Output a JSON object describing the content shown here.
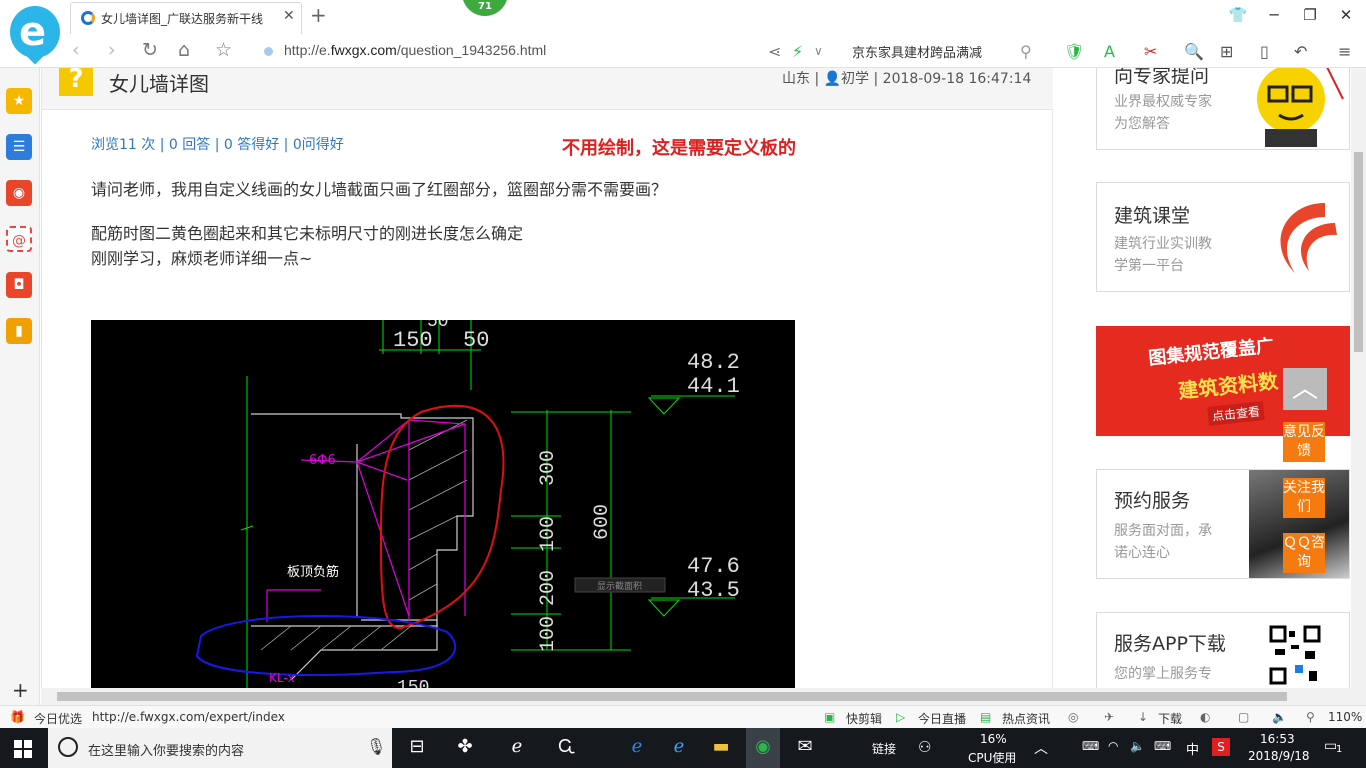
{
  "browser": {
    "tab_title": "女儿墙详图_广联达服务新干线",
    "tab_close": "✕",
    "new_tab": "+",
    "badge_count": "71",
    "url_prefix": "http://e.",
    "url_domain": "fwxgx.com",
    "url_path": "/question_1943256.html",
    "search_text": "京东家具建材跨品满减"
  },
  "question": {
    "title": "女儿墙详图",
    "meta": "山东 | 👤初学 | 2018-09-18 16:47:14",
    "stats": "浏览11 次 | 0 回答 | 0 答得好 | 0问得好",
    "note": "不用绘制，这是需要定义板的",
    "line1": "请问老师，我用自定义线画的女儿墙截面只画了红圈部分，篮圈部分需不需要画？",
    "line2": "配筋时图二黄色圈起来和其它未标明尺寸的刚进长度怎么确定",
    "line3": "刚刚学习，麻烦老师详细一点~"
  },
  "cad": {
    "dims": [
      "150",
      "50",
      "50",
      "48.2",
      "44.1",
      "300",
      "100",
      "200",
      "100",
      "600",
      "47.6",
      "43.5"
    ],
    "rebar_label": "6Φ6",
    "slab_label": "板顶负筋",
    "beam_label": "KL-x",
    "bottom_label": "150",
    "ghost_label": "显示截面积"
  },
  "sidebar_right": {
    "expert": {
      "title": "向专家提问",
      "sub1": "业界最权威专家",
      "sub2": "为您解答"
    },
    "course": {
      "title": "建筑课堂",
      "sub1": "建筑行业实训教",
      "sub2": "学第一平台"
    },
    "banner": {
      "line1": "图集规范覆盖广",
      "line2": "建筑资料数",
      "button": "点击查看"
    },
    "service": {
      "title": "预约服务",
      "sub1": "服务面对面，承",
      "sub2": "诺心连心"
    },
    "app": {
      "title": "服务APP下载",
      "sub1": "您的掌上服务专"
    }
  },
  "float_buttons": {
    "top": "︿",
    "feedback": "意见反馈",
    "follow": "关注我们",
    "qq": "ＱＱ咨询"
  },
  "statusbar": {
    "today": "今日优选",
    "link_url": "http://e.fwxgx.com/expert/index",
    "clip": "快剪辑",
    "live": "今日直播",
    "news": "热点资讯",
    "download": "下载",
    "zoom": "110%"
  },
  "taskbar": {
    "search_placeholder": "在这里输入你要搜索的内容",
    "link": "链接",
    "cpu_percent": "16%",
    "cpu_label": "CPU使用",
    "ime": "中",
    "time": "16:53",
    "date": "2018/9/18",
    "notifications": "1"
  },
  "colors": {
    "accent_blue": "#2f77c0",
    "alert_red": "#e02020",
    "cad_green": "#00e000",
    "float_orange": "#f57b10"
  }
}
